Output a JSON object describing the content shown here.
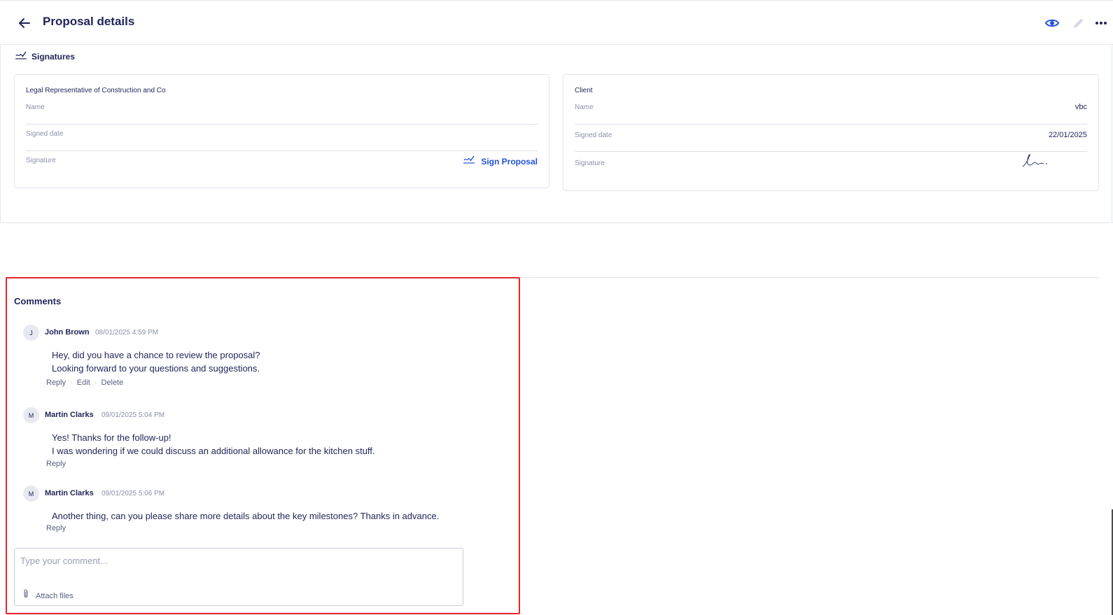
{
  "header": {
    "title": "Proposal details",
    "back_icon": "arrow-left-icon",
    "actions": [
      "eye-icon",
      "pencil-icon",
      "more-horizontal-icon"
    ]
  },
  "signatures": {
    "section_label": "Signatures",
    "left": {
      "title": "Legal Representative of Construction and Co",
      "name_label": "Name",
      "name_value": "",
      "signed_date_label": "Signed date",
      "signed_date_value": "",
      "signature_label": "Signature",
      "sign_button": "Sign Proposal"
    },
    "right": {
      "title": "Client",
      "name_label": "Name",
      "name_value": "vbc",
      "signed_date_label": "Signed date",
      "signed_date_value": "22/01/2025",
      "signature_label": "Signature"
    }
  },
  "comments": {
    "title": "Comments",
    "items": [
      {
        "initial": "J",
        "author": "John Brown",
        "time": "08/01/2025 4:59 PM",
        "lines": [
          "Hey, did you have a chance to review the proposal?",
          "Looking forward to your questions and suggestions."
        ],
        "actions": [
          "Reply",
          "Edit",
          "Delete"
        ]
      },
      {
        "initial": "M",
        "author": "Martin Clarks",
        "time": "09/01/2025 5:04 PM",
        "lines": [
          "Yes! Thanks for the follow-up!",
          "I was wondering if we could discuss an additional allowance for the kitchen stuff."
        ],
        "actions": [
          "Reply"
        ]
      },
      {
        "initial": "M",
        "author": "Martin Clarks",
        "time": "09/01/2025 5:06 PM",
        "lines": [
          "Another thing, can you please share more details about the key milestones? Thanks in advance."
        ],
        "actions": [
          "Reply"
        ]
      }
    ],
    "input": {
      "placeholder": "Type your comment...",
      "value": "",
      "attach_label": "Attach files"
    }
  },
  "colors": {
    "text": "#1f2456",
    "muted": "#8a8fa8",
    "accent": "#2453d4",
    "highlight": "#e8242a"
  }
}
